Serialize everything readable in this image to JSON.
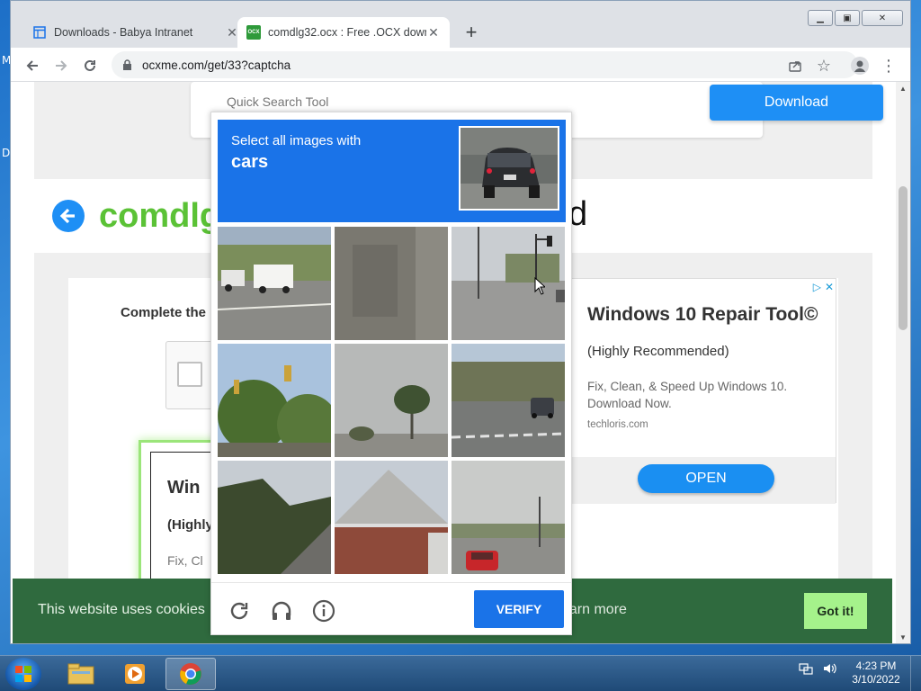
{
  "desktop": {
    "side_letters": [
      "M",
      "D"
    ]
  },
  "browser": {
    "tabs": [
      {
        "title": "Downloads - Babya Intranet",
        "favicon": "page-icon",
        "active": false
      },
      {
        "title": "comdlg32.ocx : Free .OCX downl",
        "favicon": "ocx-icon",
        "favicon_text": "OCX",
        "active": true
      }
    ],
    "new_tab": "+",
    "url": "ocxme.com/get/33?captcha"
  },
  "page": {
    "search_placeholder": "Quick Search Tool",
    "download_label": "Download",
    "heading": "comdlg",
    "heading_tail": "d",
    "complete_text": "Complete the",
    "left_ad": {
      "title": "Win",
      "subtitle": "(Highly",
      "fix": "Fix, Cl"
    },
    "ad": {
      "title": "Windows 10 Repair Tool©",
      "subtitle": "(Highly Recommended)",
      "description": "Fix, Clean, & Speed Up Windows 10. Download Now.",
      "domain": "techloris.com",
      "open_label": "OPEN"
    }
  },
  "cookie": {
    "text": "This website uses cookies",
    "learn_more": "earn more",
    "got_it": "Got it!"
  },
  "captcha": {
    "instruction": "Select all images with",
    "target": "cars",
    "verify_label": "VERIFY",
    "tiles": [
      "road-with-truck-and-trailer",
      "stone-wall-texture",
      "intersection-with-traffic-lights",
      "trees-and-traffic-light",
      "palm-tree-sky",
      "road-with-car",
      "palm-plants-road",
      "house-roof",
      "road-with-red-car"
    ]
  },
  "taskbar": {
    "time": "4:23 PM",
    "date": "3/10/2022"
  },
  "colors": {
    "accent_blue": "#1a73e8",
    "heading_green": "#5bc236",
    "cookie_green": "#2f6a3e",
    "got_it_green": "#a5f28b"
  }
}
